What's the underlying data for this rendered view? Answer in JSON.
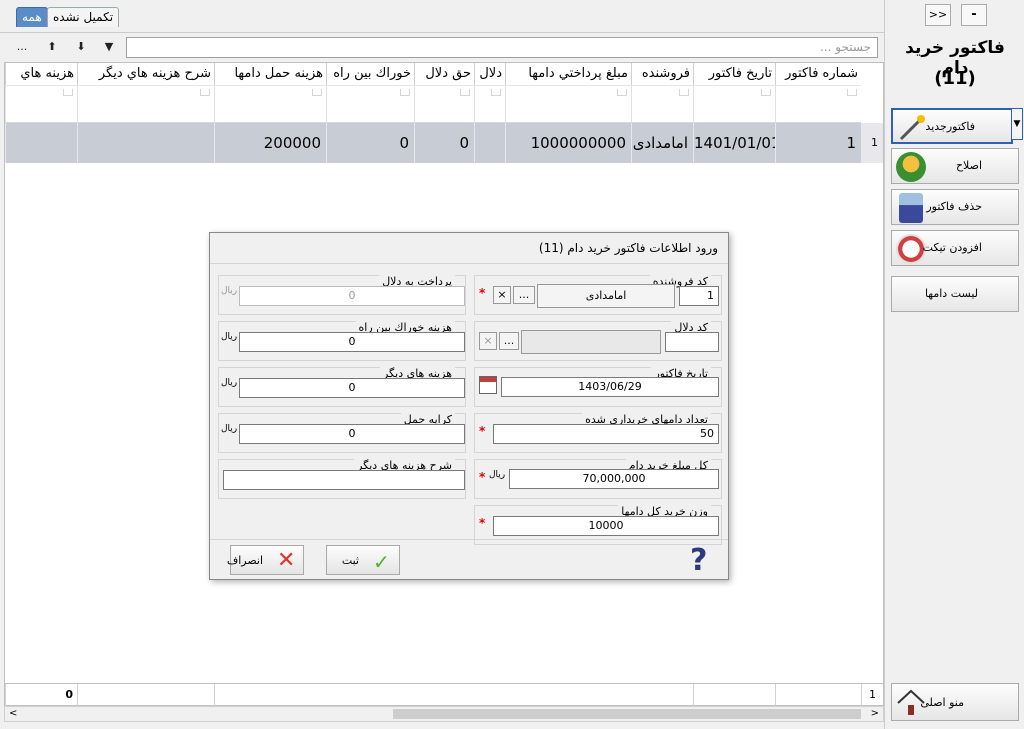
{
  "tabs": {
    "all": "همه",
    "incomplete": "تکمیل نشده"
  },
  "toolbar": {
    "more": "...",
    "down": "⬇",
    "up": "⬆",
    "filter": "▼",
    "search_placeholder": "جستجو ..."
  },
  "grid": {
    "columns": [
      "شماره فاکتور",
      "تاریخ فاکتور",
      "فروشنده",
      "مبلغ پرداختي دامها",
      "دلال",
      "حق دلال",
      "خوراك بين راه",
      "هزينه حمل دامها",
      "شرح هزينه هاي ديگر",
      "هزينه هاي"
    ],
    "row": {
      "number": "1",
      "date": "1401/01/01",
      "seller": "امامدادی",
      "amount": "1000000000",
      "broker": "",
      "broker_fee": "0",
      "feed": "0",
      "transport": "200000",
      "other_desc": "",
      "other_cost": ""
    },
    "row_indicator": "1",
    "footer_count": "1",
    "footer_total": "0"
  },
  "sidebar": {
    "collapse": "-",
    "expand": ">>",
    "title": "فاکتور خريد دام",
    "count": "(11)",
    "new_invoice": "فاکتورجدید",
    "edit": "اصلاح",
    "delete_invoice": "حذف فاکتور",
    "add_ticket": "افزودن تيکت",
    "livestock_list": "ليست دامها",
    "main_menu": "منو اصلی"
  },
  "dialog": {
    "title": "ورود اطلاعات فاکتور خريد دام (11)",
    "seller_code_label": "کد فروشنده",
    "seller_code": "1",
    "seller_name": "امامدادی",
    "broker_code_label": "کد دلال",
    "broker_code": "",
    "broker_name": "",
    "date_label": "تاريخ فاکتور",
    "date": "1403/06/29",
    "count_label": "تعداد دامهاي خريداري شده",
    "count": "50",
    "total_label": "کل مبلغ خريد دام",
    "total": "70,000,000",
    "weight_label": "وزن خريد کل دامها",
    "weight": "10000",
    "broker_pay_label": "پرداخت به دلال",
    "broker_pay": "0",
    "feed_label": "هزينه خوراك بين راه",
    "feed": "0",
    "other_cost_label": "هزينه هاي ديگر",
    "other_cost": "0",
    "transport_label": "کرايه حمل",
    "transport": "0",
    "other_desc_label": "شرح هزينه هاي ديگر",
    "other_desc": "",
    "unit": "ريال",
    "ellipsis": "...",
    "clear": "×",
    "required": "*",
    "save": "ثبت",
    "cancel": "انصراف"
  }
}
